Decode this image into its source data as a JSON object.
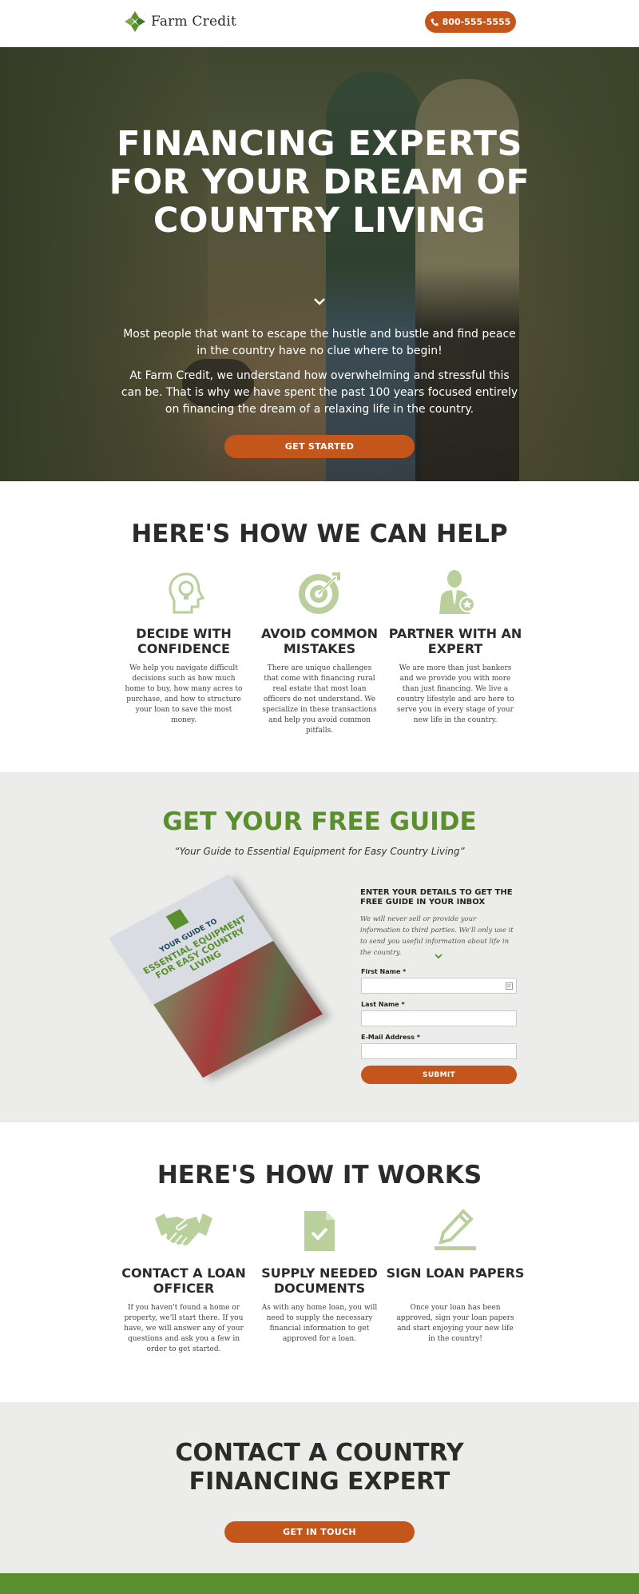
{
  "header": {
    "logo_text": "Farm Credit",
    "phone_label": "800-555-5555"
  },
  "hero": {
    "title": "FINANCING EXPERTS FOR YOUR DREAM OF COUNTRY LIVING",
    "paragraph1": "Most people that want to escape the hustle and bustle and find peace in the country have no clue where to begin!",
    "paragraph2": "At Farm Credit, we understand how overwhelming and stressful this can be. That is why we have spent the past 100 years focused entirely on financing the dream of a relaxing life in the country.",
    "cta_label": "GET STARTED"
  },
  "help": {
    "title": "HERE'S HOW WE CAN HELP",
    "items": [
      {
        "icon": "lightbulb-head-icon",
        "heading": "DECIDE WITH CONFIDENCE",
        "text": "We help you navigate difficult decisions such as how much home to buy, how many acres to purchase, and how to structure your loan to save the most money."
      },
      {
        "icon": "target-icon",
        "heading": "AVOID COMMON MISTAKES",
        "text": "There are unique challenges that come with financing rural real estate that most loan officers do not understand. We specialize in these transactions and help you avoid common pitfalls."
      },
      {
        "icon": "expert-person-icon",
        "heading": "PARTNER WITH AN EXPERT",
        "text": "We are more than just bankers and we provide you with more than just financing. We live a country lifestyle and are here to serve you in every stage of your new life in the country."
      }
    ]
  },
  "guide": {
    "title": "GET YOUR FREE GUIDE",
    "subtitle": "“Your Guide to Essential Equipment for Easy Country Living”",
    "book_line1": "YOUR GUIDE TO",
    "book_line2": "ESSENTIAL EQUIPMENT FOR EASY COUNTRY LIVING",
    "form_heading": "ENTER YOUR DETAILS TO GET THE FREE GUIDE IN YOUR INBOX",
    "form_note": "We will never sell or provide your information to third parties. We'll only use it to send you useful information about life in the country.",
    "first_name_label": "First Name *",
    "last_name_label": "Last Name *",
    "email_label": "E-Mail Address *",
    "submit_label": "SUBMIT"
  },
  "works": {
    "title": "HERE'S HOW IT WORKS",
    "items": [
      {
        "icon": "handshake-icon",
        "heading": "CONTACT A LOAN OFFICER",
        "text": "If you haven't found a home or property, we'll start there. If you have, we will answer any of your questions and ask you a few in order to get started."
      },
      {
        "icon": "document-check-icon",
        "heading": "SUPPLY NEEDED DOCUMENTS",
        "text": "As with any home loan, you will need to supply the necessary financial information to get approved for a loan."
      },
      {
        "icon": "pencil-sign-icon",
        "heading": "SIGN LOAN PAPERS",
        "text": "Once your loan has been approved, sign your loan papers and start enjoying your new life in the country!"
      }
    ]
  },
  "contact": {
    "title": "CONTACT A COUNTRY FINANCING EXPERT",
    "cta_label": "GET IN TOUCH"
  },
  "colors": {
    "accent_orange": "#c4561b",
    "brand_green": "#5a8f2e",
    "icon_green": "#b9cf9c",
    "section_gray": "#ecedea"
  }
}
